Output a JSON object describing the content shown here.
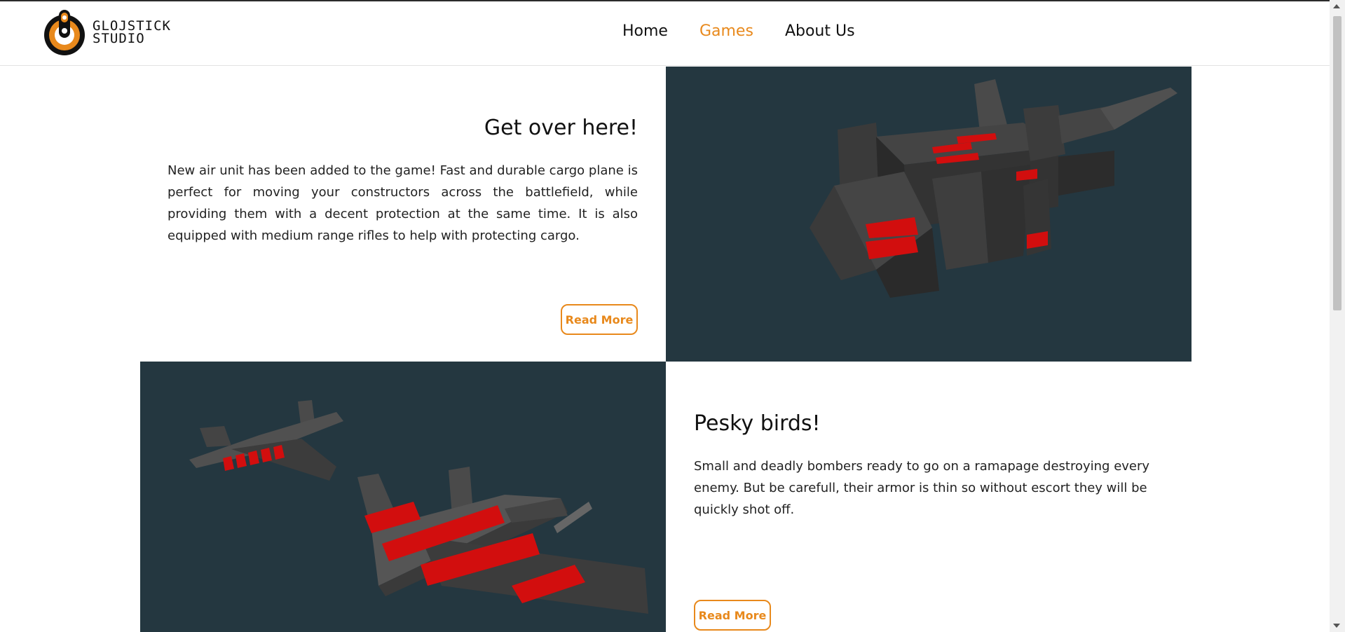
{
  "brand": {
    "logo_text_line1": "GLOJSTICK",
    "logo_text_line2": "STUDIO"
  },
  "nav": {
    "items": [
      {
        "label": "Home"
      },
      {
        "label": "Games"
      },
      {
        "label": "About Us"
      }
    ],
    "active": "Games"
  },
  "colors": {
    "accent": "#e8891c",
    "image_bg": "#243740",
    "red": "#d20e0e"
  },
  "posts": [
    {
      "title": "Get over here!",
      "text": "New air unit has been added to the game! Fast and durable cargo plane is perfect for moving your constructors across the battlefield, while providing them with a decent protection at the same time. It is also equipped with medium range rifles to help with protecting cargo.",
      "button": "Read More"
    },
    {
      "title": "Pesky birds!",
      "text": "Small and deadly bombers ready to go on a ramapage destroying every enemy. But be carefull, their armor is thin so without escort they will be quickly shot off.",
      "button": "Read More"
    }
  ]
}
